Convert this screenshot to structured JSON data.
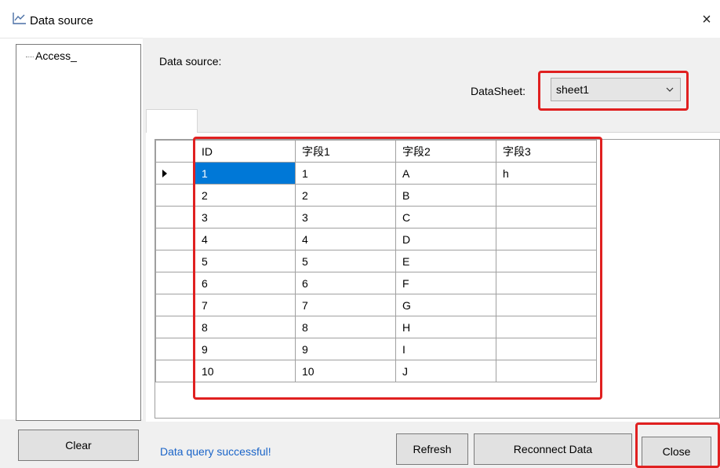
{
  "window": {
    "title": "Data source",
    "icon": "line-chart-icon",
    "close_glyph": "×"
  },
  "tree": {
    "items": [
      {
        "label": "Access_"
      }
    ]
  },
  "left": {
    "clear_label": "Clear"
  },
  "main": {
    "data_source_label": "Data source:",
    "datasheet_label": "DataSheet:",
    "datasheet_value": "sheet1"
  },
  "table": {
    "columns": [
      "ID",
      "字段1",
      "字段2",
      "字段3"
    ],
    "rows": [
      [
        "1",
        "1",
        "A",
        "h"
      ],
      [
        "2",
        "2",
        "B",
        ""
      ],
      [
        "3",
        "3",
        "C",
        ""
      ],
      [
        "4",
        "4",
        "D",
        ""
      ],
      [
        "5",
        "5",
        "E",
        ""
      ],
      [
        "6",
        "6",
        "F",
        ""
      ],
      [
        "7",
        "7",
        "G",
        ""
      ],
      [
        "8",
        "8",
        "H",
        ""
      ],
      [
        "9",
        "9",
        "I",
        ""
      ],
      [
        "10",
        "10",
        "J",
        ""
      ]
    ]
  },
  "footer": {
    "status_text": "Data query successful!",
    "refresh_label": "Refresh",
    "reconnect_label": "Reconnect Data",
    "close_label": "Close"
  },
  "colors": {
    "accent": "#0078d7",
    "highlight": "#e02020",
    "status": "#1a64c8"
  }
}
